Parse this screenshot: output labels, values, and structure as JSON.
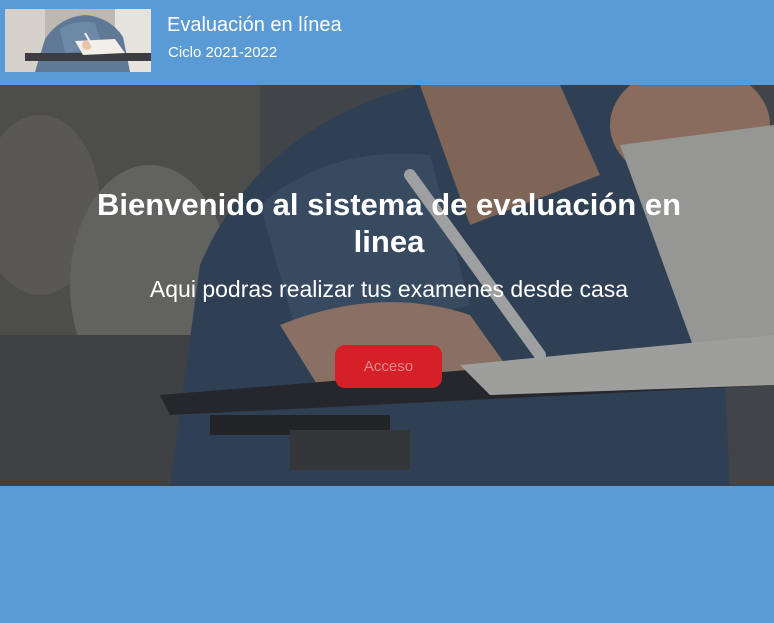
{
  "header": {
    "logo_icon": "student-exam-photo",
    "title": "Evaluación en línea",
    "subtitle": "Ciclo 2021-2022"
  },
  "hero": {
    "background_image": "student-writing-exam-photo",
    "title": "Bienvenido al sistema de evaluación en linea",
    "subtitle": "Aqui podras realizar tus examenes desde casa",
    "button_label": "Acceso"
  },
  "colors": {
    "page_background": "#5b9bd5",
    "button_background": "#d42026",
    "button_text": "#e6898c",
    "text": "#ffffff"
  }
}
